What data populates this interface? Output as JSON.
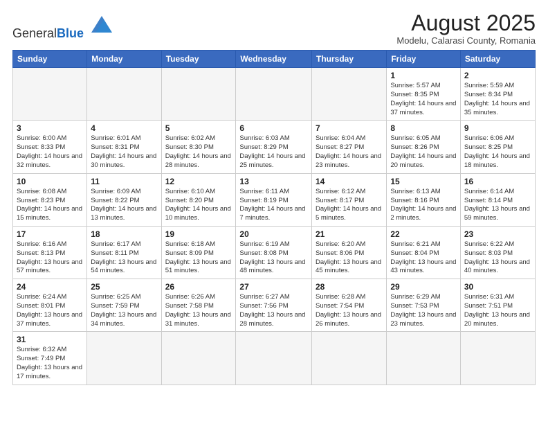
{
  "header": {
    "logo_general": "General",
    "logo_blue": "Blue",
    "month_title": "August 2025",
    "location": "Modelu, Calarasi County, Romania"
  },
  "weekdays": [
    "Sunday",
    "Monday",
    "Tuesday",
    "Wednesday",
    "Thursday",
    "Friday",
    "Saturday"
  ],
  "weeks": [
    [
      {
        "day": "",
        "info": ""
      },
      {
        "day": "",
        "info": ""
      },
      {
        "day": "",
        "info": ""
      },
      {
        "day": "",
        "info": ""
      },
      {
        "day": "",
        "info": ""
      },
      {
        "day": "1",
        "info": "Sunrise: 5:57 AM\nSunset: 8:35 PM\nDaylight: 14 hours and 37 minutes."
      },
      {
        "day": "2",
        "info": "Sunrise: 5:59 AM\nSunset: 8:34 PM\nDaylight: 14 hours and 35 minutes."
      }
    ],
    [
      {
        "day": "3",
        "info": "Sunrise: 6:00 AM\nSunset: 8:33 PM\nDaylight: 14 hours and 32 minutes."
      },
      {
        "day": "4",
        "info": "Sunrise: 6:01 AM\nSunset: 8:31 PM\nDaylight: 14 hours and 30 minutes."
      },
      {
        "day": "5",
        "info": "Sunrise: 6:02 AM\nSunset: 8:30 PM\nDaylight: 14 hours and 28 minutes."
      },
      {
        "day": "6",
        "info": "Sunrise: 6:03 AM\nSunset: 8:29 PM\nDaylight: 14 hours and 25 minutes."
      },
      {
        "day": "7",
        "info": "Sunrise: 6:04 AM\nSunset: 8:27 PM\nDaylight: 14 hours and 23 minutes."
      },
      {
        "day": "8",
        "info": "Sunrise: 6:05 AM\nSunset: 8:26 PM\nDaylight: 14 hours and 20 minutes."
      },
      {
        "day": "9",
        "info": "Sunrise: 6:06 AM\nSunset: 8:25 PM\nDaylight: 14 hours and 18 minutes."
      }
    ],
    [
      {
        "day": "10",
        "info": "Sunrise: 6:08 AM\nSunset: 8:23 PM\nDaylight: 14 hours and 15 minutes."
      },
      {
        "day": "11",
        "info": "Sunrise: 6:09 AM\nSunset: 8:22 PM\nDaylight: 14 hours and 13 minutes."
      },
      {
        "day": "12",
        "info": "Sunrise: 6:10 AM\nSunset: 8:20 PM\nDaylight: 14 hours and 10 minutes."
      },
      {
        "day": "13",
        "info": "Sunrise: 6:11 AM\nSunset: 8:19 PM\nDaylight: 14 hours and 7 minutes."
      },
      {
        "day": "14",
        "info": "Sunrise: 6:12 AM\nSunset: 8:17 PM\nDaylight: 14 hours and 5 minutes."
      },
      {
        "day": "15",
        "info": "Sunrise: 6:13 AM\nSunset: 8:16 PM\nDaylight: 14 hours and 2 minutes."
      },
      {
        "day": "16",
        "info": "Sunrise: 6:14 AM\nSunset: 8:14 PM\nDaylight: 13 hours and 59 minutes."
      }
    ],
    [
      {
        "day": "17",
        "info": "Sunrise: 6:16 AM\nSunset: 8:13 PM\nDaylight: 13 hours and 57 minutes."
      },
      {
        "day": "18",
        "info": "Sunrise: 6:17 AM\nSunset: 8:11 PM\nDaylight: 13 hours and 54 minutes."
      },
      {
        "day": "19",
        "info": "Sunrise: 6:18 AM\nSunset: 8:09 PM\nDaylight: 13 hours and 51 minutes."
      },
      {
        "day": "20",
        "info": "Sunrise: 6:19 AM\nSunset: 8:08 PM\nDaylight: 13 hours and 48 minutes."
      },
      {
        "day": "21",
        "info": "Sunrise: 6:20 AM\nSunset: 8:06 PM\nDaylight: 13 hours and 45 minutes."
      },
      {
        "day": "22",
        "info": "Sunrise: 6:21 AM\nSunset: 8:04 PM\nDaylight: 13 hours and 43 minutes."
      },
      {
        "day": "23",
        "info": "Sunrise: 6:22 AM\nSunset: 8:03 PM\nDaylight: 13 hours and 40 minutes."
      }
    ],
    [
      {
        "day": "24",
        "info": "Sunrise: 6:24 AM\nSunset: 8:01 PM\nDaylight: 13 hours and 37 minutes."
      },
      {
        "day": "25",
        "info": "Sunrise: 6:25 AM\nSunset: 7:59 PM\nDaylight: 13 hours and 34 minutes."
      },
      {
        "day": "26",
        "info": "Sunrise: 6:26 AM\nSunset: 7:58 PM\nDaylight: 13 hours and 31 minutes."
      },
      {
        "day": "27",
        "info": "Sunrise: 6:27 AM\nSunset: 7:56 PM\nDaylight: 13 hours and 28 minutes."
      },
      {
        "day": "28",
        "info": "Sunrise: 6:28 AM\nSunset: 7:54 PM\nDaylight: 13 hours and 26 minutes."
      },
      {
        "day": "29",
        "info": "Sunrise: 6:29 AM\nSunset: 7:53 PM\nDaylight: 13 hours and 23 minutes."
      },
      {
        "day": "30",
        "info": "Sunrise: 6:31 AM\nSunset: 7:51 PM\nDaylight: 13 hours and 20 minutes."
      }
    ],
    [
      {
        "day": "31",
        "info": "Sunrise: 6:32 AM\nSunset: 7:49 PM\nDaylight: 13 hours and 17 minutes."
      },
      {
        "day": "",
        "info": ""
      },
      {
        "day": "",
        "info": ""
      },
      {
        "day": "",
        "info": ""
      },
      {
        "day": "",
        "info": ""
      },
      {
        "day": "",
        "info": ""
      },
      {
        "day": "",
        "info": ""
      }
    ]
  ]
}
